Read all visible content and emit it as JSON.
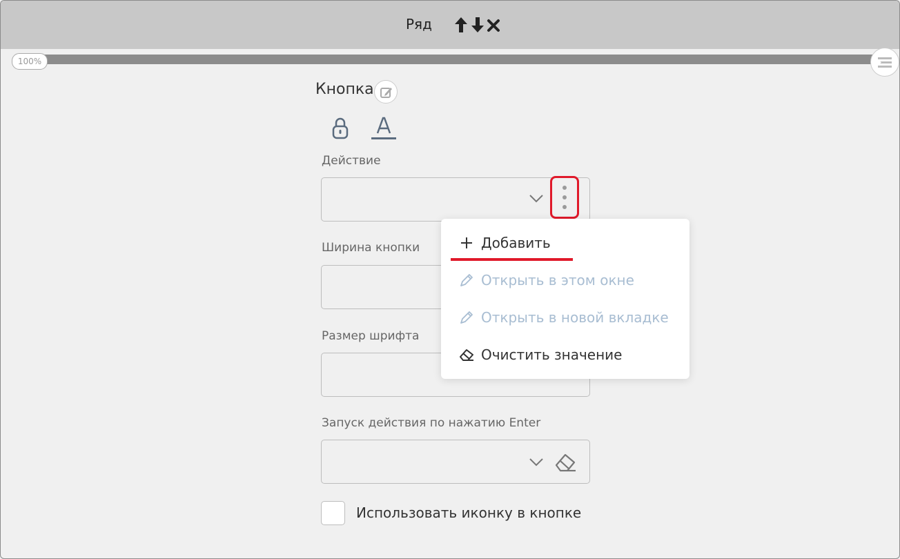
{
  "header": {
    "title": "Ряд"
  },
  "toolbar": {
    "zoom": "100%",
    "progress_percent": 100
  },
  "panel": {
    "title": "Кнопка"
  },
  "fields": {
    "action": {
      "label": "Действие",
      "value": ""
    },
    "button_width": {
      "label": "Ширина кнопки",
      "value": ""
    },
    "font_size": {
      "label": "Размер шрифта",
      "value": ""
    },
    "enter_action": {
      "label": "Запуск действия по нажатию Enter",
      "value": ""
    }
  },
  "dropdown": {
    "items": [
      {
        "label": "Добавить",
        "icon": "plus-icon",
        "enabled": true
      },
      {
        "label": "Открыть в этом окне",
        "icon": "pencil-icon",
        "enabled": false
      },
      {
        "label": "Открыть в новой вкладке",
        "icon": "pencil-icon",
        "enabled": false
      },
      {
        "label": "Очистить значение",
        "icon": "eraser-icon",
        "enabled": true
      }
    ]
  },
  "checkbox": {
    "label": "Использовать иконку в кнопке",
    "checked": false
  },
  "colors": {
    "highlight": "#e0192a",
    "disabled_text": "#a8bdd2",
    "header_bg": "#c8c8c8"
  }
}
